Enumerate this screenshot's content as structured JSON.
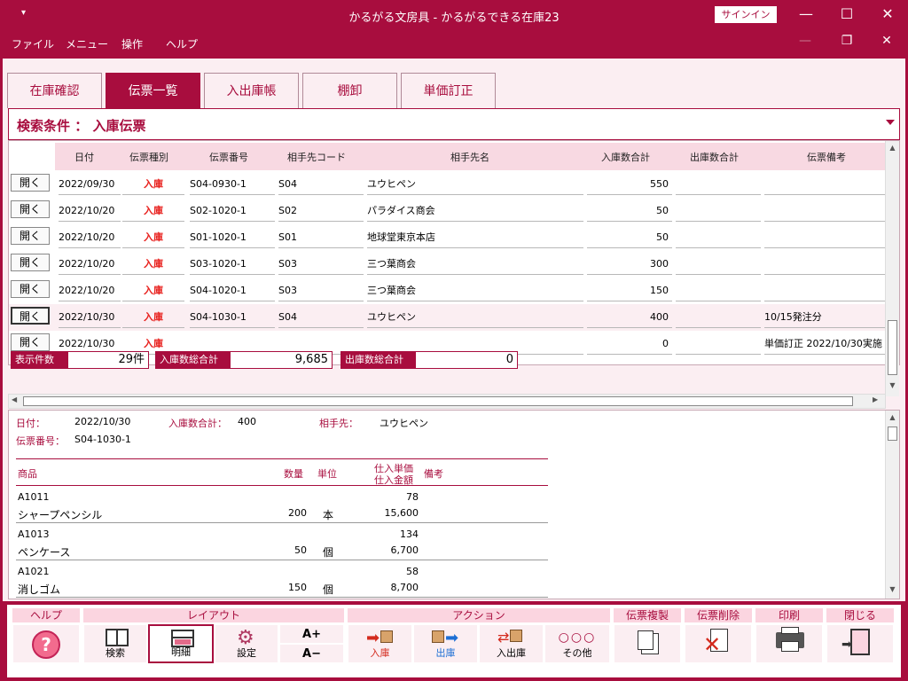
{
  "window": {
    "title": "かるがる文房具 - かるがるできる在庫23",
    "quick_access": "▾",
    "signin": "サインイン",
    "minimize": "—",
    "maximize": "☐",
    "close": "✕"
  },
  "menu": {
    "items": [
      "ファイル",
      "メニュー",
      "操作",
      "ヘルプ"
    ],
    "min": "—",
    "restore": "❐",
    "close": "✕"
  },
  "tabs": [
    "在庫確認",
    "伝票一覧",
    "入出庫帳",
    "棚卸",
    "単価訂正"
  ],
  "active_tab": "伝票一覧",
  "search": {
    "label": "検索条件 ： 入庫伝票"
  },
  "list": {
    "headers": [
      "日付",
      "伝票種別",
      "伝票番号",
      "相手先コード",
      "相手先名",
      "入庫数合計",
      "出庫数合計",
      "伝票備考"
    ],
    "open_label": "開く",
    "rows": [
      {
        "date": "2022/09/30",
        "type": "入庫",
        "no": "S04-0930-1",
        "code": "S04",
        "name": "ユウヒペン",
        "in": "550",
        "out": "",
        "note": ""
      },
      {
        "date": "2022/10/20",
        "type": "入庫",
        "no": "S02-1020-1",
        "code": "S02",
        "name": "パラダイス商会",
        "in": "50",
        "out": "",
        "note": ""
      },
      {
        "date": "2022/10/20",
        "type": "入庫",
        "no": "S01-1020-1",
        "code": "S01",
        "name": "地球堂東京本店",
        "in": "50",
        "out": "",
        "note": ""
      },
      {
        "date": "2022/10/20",
        "type": "入庫",
        "no": "S03-1020-1",
        "code": "S03",
        "name": "三つ葉商会",
        "in": "300",
        "out": "",
        "note": ""
      },
      {
        "date": "2022/10/20",
        "type": "入庫",
        "no": "S04-1020-1",
        "code": "S03",
        "name": "三つ葉商会",
        "in": "150",
        "out": "",
        "note": ""
      },
      {
        "date": "2022/10/30",
        "type": "入庫",
        "no": "S04-1030-1",
        "code": "S04",
        "name": "ユウヒペン",
        "in": "400",
        "out": "",
        "note": "10/15発注分"
      },
      {
        "date": "2022/10/30",
        "type": "入庫",
        "no": "",
        "code": "",
        "name": "",
        "in": "0",
        "out": "",
        "note": "単価訂正 2022/10/30実施"
      }
    ]
  },
  "totals": {
    "count_label": "表示件数",
    "count": "29件",
    "in_label": "入庫数総合計",
    "in": "9,685",
    "out_label": "出庫数総合計",
    "out": "0"
  },
  "detail": {
    "date_label": "日付：",
    "date": "2022/10/30",
    "in_label": "入庫数合計：",
    "in": "400",
    "partner_label": "相手先：",
    "partner": "ユウヒペン",
    "no_label": "伝票番号：",
    "no": "S04-1030-1",
    "headers": {
      "product": "商品",
      "qty": "数量",
      "unit": "単位",
      "price1": "仕入単価",
      "price2": "仕入金額",
      "note": "備考"
    },
    "items": [
      {
        "code": "A1011",
        "name": "シャープペンシル",
        "qty": "200",
        "unit": "本",
        "price": "78",
        "amount": "15,600"
      },
      {
        "code": "A1013",
        "name": "ペンケース",
        "qty": "50",
        "unit": "個",
        "price": "134",
        "amount": "6,700"
      },
      {
        "code": "A1021",
        "name": "消しゴム",
        "qty": "150",
        "unit": "個",
        "price": "58",
        "amount": "8,700"
      }
    ]
  },
  "toolbar": {
    "help": {
      "label": "ヘルプ",
      "icon": "?"
    },
    "layout": {
      "label": "レイアウト",
      "search": "検索",
      "detail": "明細",
      "settings": "設定",
      "font_up": "A+",
      "font_down": "A−"
    },
    "action": {
      "label": "アクション",
      "in": "入庫",
      "out": "出庫",
      "inout": "入出庫",
      "other": "その他"
    },
    "copy": "伝票複製",
    "delete": "伝票削除",
    "print": "印刷",
    "close": "閉じる"
  }
}
